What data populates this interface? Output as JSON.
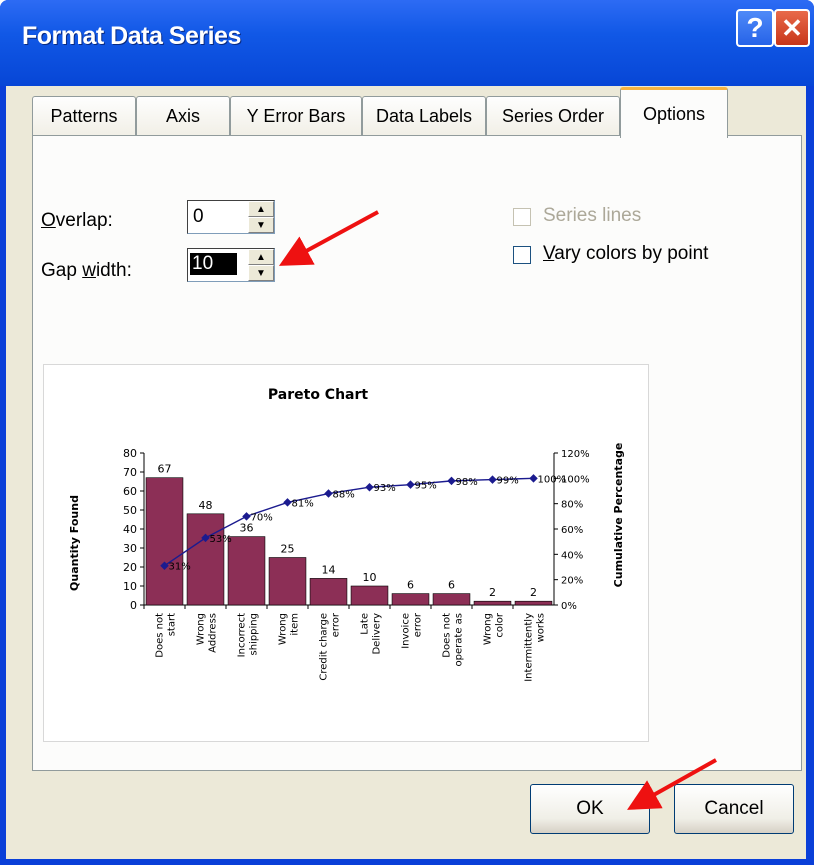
{
  "window": {
    "title": "Format Data Series",
    "help_glyph": "?",
    "close_glyph": "✕"
  },
  "tabs": [
    {
      "label": "Patterns"
    },
    {
      "label": "Axis"
    },
    {
      "label": "Y Error Bars"
    },
    {
      "label": "Data Labels"
    },
    {
      "label": "Series Order"
    },
    {
      "label": "Options",
      "active": true
    }
  ],
  "options": {
    "overlap_label": "Overlap:",
    "overlap_value": "0",
    "gap_label": "Gap width:",
    "gap_value": "10",
    "series_lines_label": "Series lines",
    "series_lines_checked": false,
    "vary_colors_label": "Vary colors by point",
    "vary_colors_checked": false
  },
  "buttons": {
    "ok": "OK",
    "cancel": "Cancel"
  },
  "colors": {
    "bar": "#8c2f56",
    "line": "#1b1b8f",
    "annotation_arrow": "#ee1111"
  },
  "chart_data": {
    "type": "bar",
    "title": "Pareto Chart",
    "ylabel": "Quantity Found",
    "y2label": "Cumulative Percentage",
    "ylim": [
      0,
      80
    ],
    "y2lim": [
      0,
      120
    ],
    "yticks": [
      "0",
      "10",
      "20",
      "30",
      "40",
      "50",
      "60",
      "70",
      "80"
    ],
    "y2ticks": [
      "0%",
      "20%",
      "40%",
      "60%",
      "80%",
      "100%",
      "120%"
    ],
    "categories": [
      "Does not start",
      "Wrong Address",
      "Incorrect shipping",
      "Wrong item",
      "Credit charge error",
      "Late Delivery",
      "Invoice error",
      "Does not operate as",
      "Wrong color",
      "Intermittently works"
    ],
    "series": [
      {
        "values": [
          67,
          48,
          36,
          25,
          14,
          10,
          6,
          6,
          2,
          2
        ],
        "labels": [
          "67",
          "48",
          "36",
          "25",
          "14",
          "10",
          "6",
          "6",
          "2",
          "2"
        ]
      },
      {
        "type": "line",
        "values": [
          31,
          53,
          70,
          81,
          88,
          93,
          95,
          98,
          99,
          100
        ],
        "labels": [
          "31%",
          "53%",
          "70%",
          "81%",
          "88%",
          "93%",
          "95%",
          "98%",
          "99%",
          "100%"
        ]
      }
    ]
  }
}
